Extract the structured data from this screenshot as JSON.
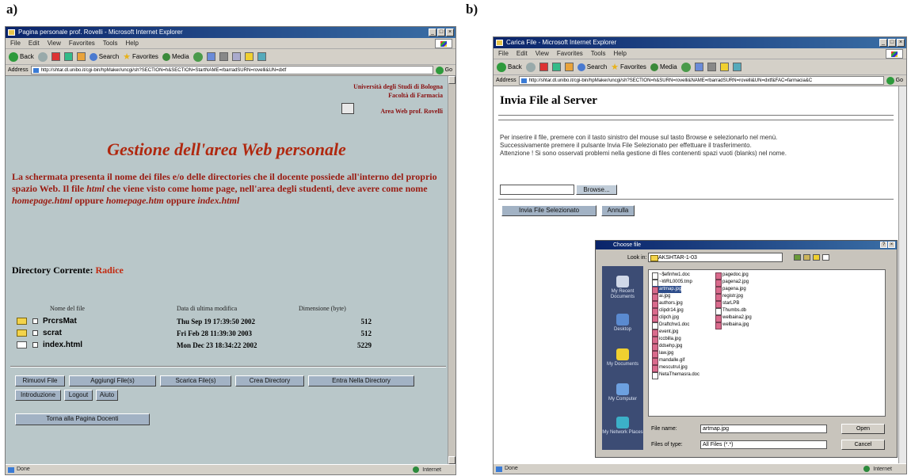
{
  "panels": {
    "a": "a)",
    "b": "b)"
  },
  "window_a": {
    "title": "Pagina personale prof. Rovelli - Microsoft Internet Explorer",
    "menu": [
      "File",
      "Edit",
      "View",
      "Favorites",
      "Tools",
      "Help"
    ],
    "toolbar": {
      "back": "Back",
      "search": "Search",
      "favorites": "Favorites",
      "media": "Media"
    },
    "address_label": "Address",
    "address_url": "http://shtar.dl.unibo.it/cgi-bin/hpMaker/uncgi/sh?SECTION=h&SECTION=StartNAME=rbarradSURN=rovelli&UN=dxtf",
    "go": "Go",
    "status": "Done",
    "zone": "Internet",
    "univ_lines": [
      "Università degli Studi di Bologna",
      "Facoltà di Farmacia"
    ],
    "area_web": "Area Web prof. Rovelli",
    "page_title": "Gestione dell'area Web personale",
    "para": {
      "p1": "La schermata presenta il nome dei files e/o delle directories che il docente possiede all'interno del proprio spazio Web. Il file ",
      "html": "html",
      "p2": " che viene visto come home page, nell'area degli studenti, deve avere come nome ",
      "home1": "homepage.html",
      "p3": " oppure ",
      "home2": "homepage.htm",
      "p4": " oppure ",
      "index": "index.html"
    },
    "dir_label": "Directory Corrente:",
    "dir_value": "Radice",
    "headers": {
      "name": "Nome del file",
      "date": "Data di ultima modifica",
      "size": "Dimensione (byte)"
    },
    "files": [
      {
        "name": "PrcrsMat",
        "date": "Thu Sep 19 17:39:50 2002",
        "size": "512"
      },
      {
        "name": "scrat",
        "date": "Fri Feb 28 11:39:30 2003",
        "size": "512"
      },
      {
        "name": "index.html",
        "date": "Mon Dec 23 18:34:22 2002",
        "size": "5229"
      }
    ],
    "buttons": {
      "rimuovi": "Rimuovi File",
      "aggiungi": "Aggiungi File(s)",
      "scarica": "Scarica File(s)",
      "crea": "Crea Directory",
      "entra": "Entra Nella Directory",
      "intro": "Introduzione",
      "logout": "Logout",
      "aiuto": "Aiuto",
      "torna": "Torna alla Pagina Docenti"
    }
  },
  "window_b": {
    "title": "Carica File - Microsoft Internet Explorer",
    "menu": [
      "File",
      "Edit",
      "View",
      "Favorites",
      "Tools",
      "Help"
    ],
    "toolbar": {
      "back": "Back",
      "search": "Search",
      "favorites": "Favorites",
      "media": "Media"
    },
    "address_label": "Address",
    "address_url": "http://shtar.dl.unibo.it/cgi-bin/hpMaker/uncgi/sh?SECTION=h&SURN=rovelli&NAME=rbarradSURN=rovelli&UN=dxtf&FAC=farmacia&C",
    "go": "Go",
    "status": "Done",
    "zone": "Internet",
    "heading": "Invia File al Server",
    "info": [
      "Per inserire il file, premere con il tasto sinistro del mouse sul tasto Browse e selezionarlo nel menù.",
      "Successivamente premere il pulsante Invia File Selezionato per effettuare il trasferimento.",
      "Attenzione ! Si sono osservati problemi nella gestione di files contenenti spazi vuoti (blanks) nel nome."
    ],
    "browse": "Browse...",
    "send": "Invia File Selezionato",
    "cancel": "Annulla"
  },
  "dialog": {
    "title": "Choose file",
    "look_in_label": "Look in:",
    "look_in_value": "AKSHTAR-1-03",
    "places": [
      "My Recent Documents",
      "Desktop",
      "My Documents",
      "My Computer",
      "My Network Places"
    ],
    "files_col1": [
      "~$efinhw1.doc",
      "~WRL0005.tmp",
      "artmap.jpg",
      "ai.jpg",
      "authors.jpg",
      "clipdr14.jpg",
      "clipch.jpg",
      "Draftchw1.doc",
      "event.jpg",
      "iccbilla.jpg",
      "ddsehp.jpg",
      "law.jpg",
      "mandalle.gif",
      "mescutrul.jpg",
      "NetaThemasra.doc"
    ],
    "files_col2": [
      "pagedoc.jpg",
      "pagena2.jpg",
      "pagena.jpg",
      "registr.jpg",
      "starLPB",
      "Thumbs.db",
      "welbaina2.jpg",
      "welbaina.jpg"
    ],
    "selected": "artmap.jpg",
    "filename_label": "File name:",
    "filename_value": "artmap.jpg",
    "filetype_label": "Files of type:",
    "filetype_value": "All Files (*.*)",
    "open": "Open",
    "cancel": "Cancel"
  }
}
